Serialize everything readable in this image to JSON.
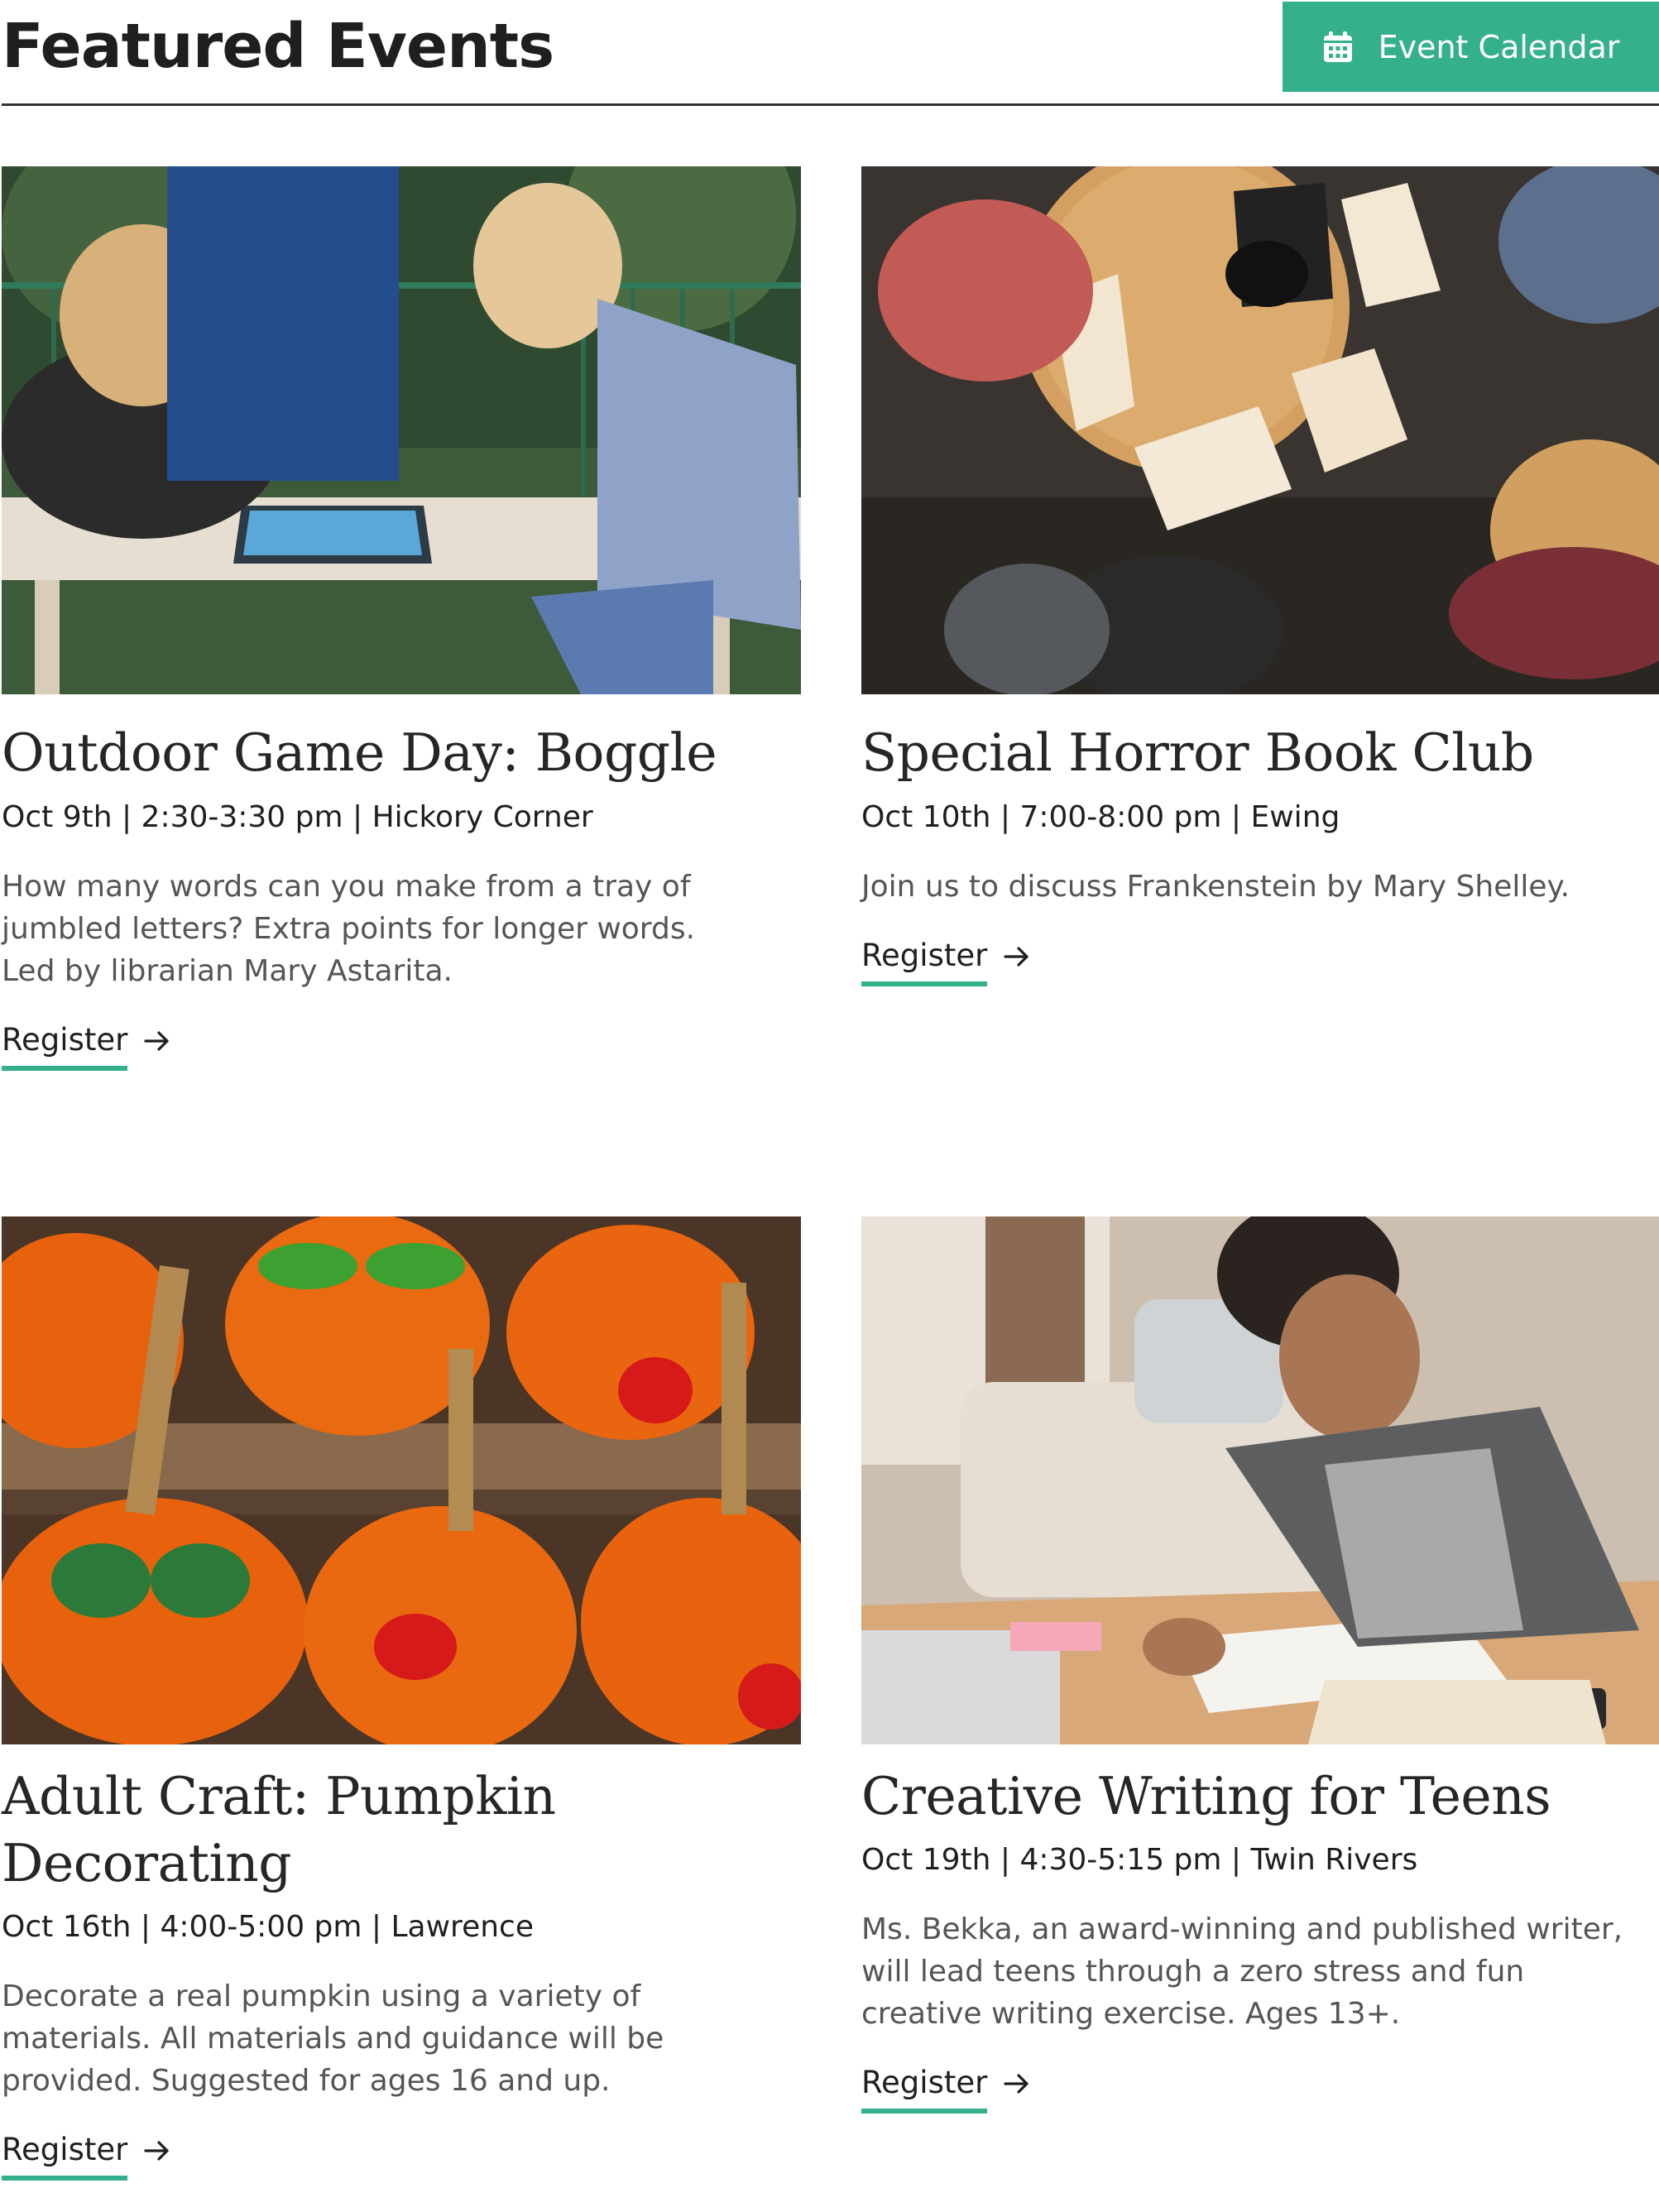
{
  "header": {
    "title": "Featured Events",
    "calendar_button_label": "Event Calendar",
    "calendar_icon": "calendar-icon"
  },
  "colors": {
    "accent": "#35b08c",
    "heading": "#1f1f1f",
    "body_text": "#555555",
    "rule": "#333333"
  },
  "events": [
    {
      "title": "Outdoor Game Day: Boggle",
      "meta": "Oct 9th | 2:30-3:30 pm | Hickory Corner",
      "description": "How many words can you make from a tray of jumbled letters? Extra points for longer words. Led by librarian Mary Astarita.",
      "register_label": "Register",
      "image": "kids-playing-boggle-photo"
    },
    {
      "title": "Special Horror Book Club",
      "meta": "Oct 10th | 7:00-8:00 pm | Ewing",
      "description": "Join us to discuss Frankenstein by Mary Shelley.",
      "register_label": "Register",
      "image": "book-club-overhead-photo"
    },
    {
      "title": "Adult Craft: Pumpkin Decorating",
      "meta": "Oct 16th | 4:00-5:00 pm | Lawrence",
      "description": "Decorate a real pumpkin using a variety of materials. All materials and guidance will be provided. Suggested for ages 16 and up.",
      "register_label": "Register",
      "image": "painted-pumpkins-photo"
    },
    {
      "title": "Creative Writing for Teens",
      "meta": "Oct 19th | 4:30-5:15 pm | Twin Rivers",
      "description": "Ms. Bekka, an award-winning and published writer, will lead teens through a zero stress and fun creative writing exercise. Ages 13+.",
      "register_label": "Register",
      "image": "teen-writing-photo"
    }
  ]
}
